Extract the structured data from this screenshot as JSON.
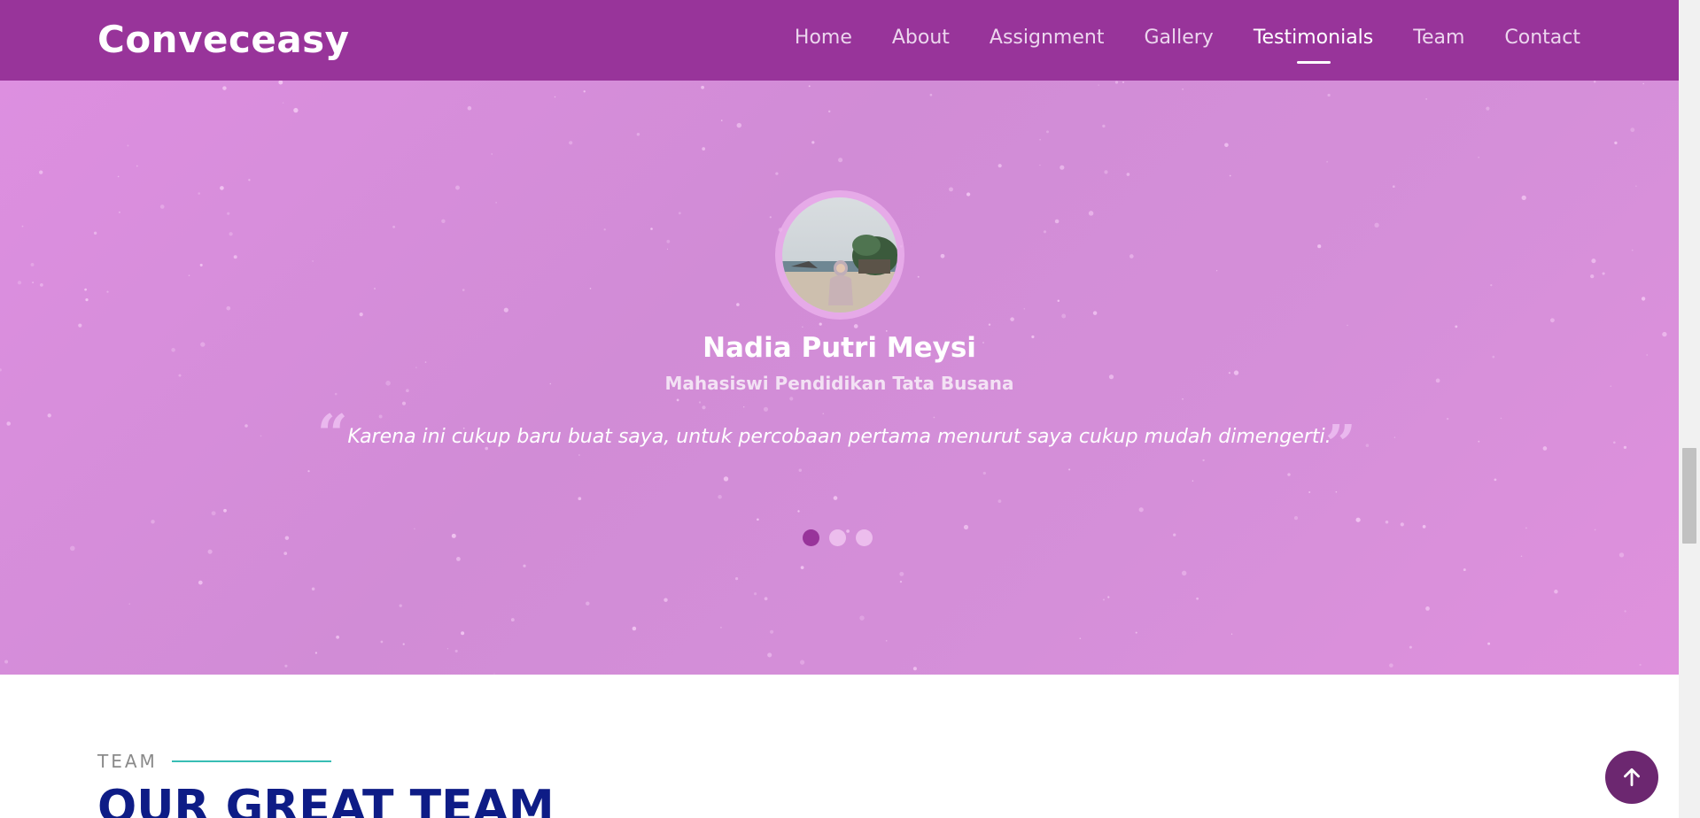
{
  "brand": {
    "name": "Conveceasy"
  },
  "nav": {
    "items": [
      {
        "label": "Home"
      },
      {
        "label": "About"
      },
      {
        "label": "Assignment"
      },
      {
        "label": "Gallery"
      },
      {
        "label": "Testimonials"
      },
      {
        "label": "Team"
      },
      {
        "label": "Contact"
      }
    ],
    "active": "Testimonials"
  },
  "testimonial": {
    "name": "Nadia Putri Meysi",
    "role": "Mahasiswi Pendidikan Tata Busana",
    "quote": "Karena ini cukup baru buat saya, untuk percobaan pertama menurut saya cukup mudah dimengerti.",
    "slide_count": 3,
    "active_slide": 1
  },
  "team": {
    "label": "TEAM",
    "title": "OUR GREAT TEAM"
  },
  "colors": {
    "header": "#98349a",
    "hero": "#d58fd9",
    "active_dot": "#98349a",
    "inactive_dot": "#ecbded",
    "team_title": "#0e1c86",
    "label_line": "#38bdb4",
    "back_to_top": "#6c2770"
  },
  "icons": {
    "back_to_top": "arrow-up-icon",
    "quote_open": "quote-open-icon",
    "quote_close": "quote-close-icon"
  }
}
